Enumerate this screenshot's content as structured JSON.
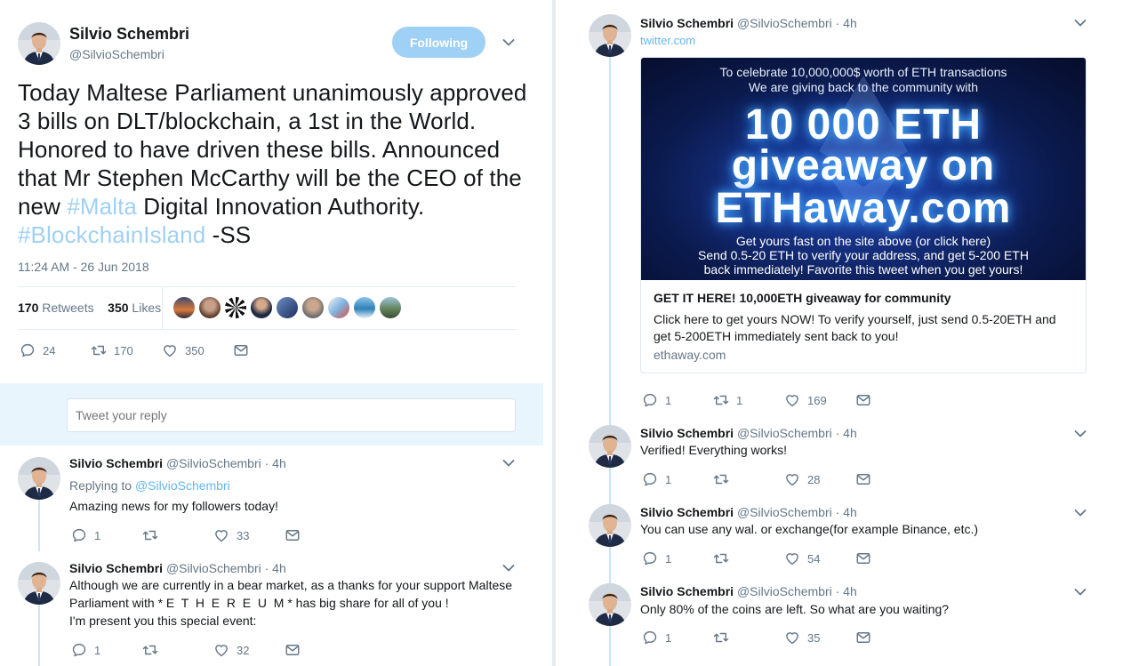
{
  "main_tweet": {
    "author_name": "Silvio Schembri",
    "author_handle": "@SilvioSchembri",
    "follow_label": "Following",
    "text_parts": [
      "Today Maltese Parliament unanimously approved 3 bills on DLT/blockchain, a 1st in the World. Honored to have driven these bills. Announced that Mr Stephen McCarthy will be the CEO of the new ",
      "#Malta",
      " Digital Innovation Authority.  ",
      "#BlockchainIsland",
      " -SS"
    ],
    "timestamp": "11:24 AM - 26 Jun 2018",
    "retweets_count": "170",
    "retweets_label": "Retweets",
    "likes_count": "350",
    "likes_label": "Likes",
    "action_replies": "24",
    "action_retweets": "170",
    "action_likes": "350"
  },
  "reply_input": {
    "placeholder": "Tweet your reply"
  },
  "left_replies": [
    {
      "name": "Silvio Schembri",
      "handle_time": "@SilvioSchembri · 4h",
      "replying_prefix": "Replying to",
      "replying_to": "@SilvioSchembri",
      "text_lines": [
        "Amazing news for my followers today!"
      ],
      "replies": "1",
      "retweets": "",
      "likes": "33"
    },
    {
      "name": "Silvio Schembri",
      "handle_time": "@SilvioSchembri · 4h",
      "text_lines": [
        "Although we are currently in a bear market, as a thanks for your support Maltese",
        "Parliament with * E  T  H  E  R  E  U  M * has big share for all of you !",
        "I'm present you this special event:"
      ],
      "replies": "1",
      "retweets": "",
      "likes": "32"
    }
  ],
  "right_tweets": [
    {
      "name": "Silvio Schembri",
      "handle_time": "@SilvioSchembri · 4h",
      "link": "twitter.com",
      "card": {
        "img_line1": "To celebrate 10,000,000$ worth of ETH transactions",
        "img_line2": "We are giving back to the community with",
        "img_big1": "10 000 ETH",
        "img_big2": "giveaway on",
        "img_big3": "ETHaway.com",
        "img_small1": "Get yours fast on the site above (or click here)",
        "img_small2": "Send 0.5-20 ETH to verify your address, and get 5-200 ETH",
        "img_small3": "back immediately! Favorite this tweet when you get yours!",
        "title": "GET IT HERE! 10,000ETH giveaway for community",
        "desc_line1": "Click here to get yours NOW! To verify yourself, just send 0.5-20ETH and",
        "desc_line2": "get 5-200ETH immediately sent back to you!",
        "domain": "ethaway.com"
      },
      "replies": "1",
      "retweets": "1",
      "likes": "169"
    },
    {
      "name": "Silvio Schembri",
      "handle_time": "@SilvioSchembri · 4h",
      "text": "Verified! Everything works!",
      "replies": "1",
      "retweets": "",
      "likes": "28"
    },
    {
      "name": "Silvio Schembri",
      "handle_time": "@SilvioSchembri · 4h",
      "text": "You can use any wal. or exchange(for example Binance, etc.)",
      "replies": "1",
      "retweets": "",
      "likes": "54"
    },
    {
      "name": "Silvio Schembri",
      "handle_time": "@SilvioSchembri · 4h",
      "text": "Only 80% of the coins are left. So what are you waiting?",
      "replies": "1",
      "retweets": "",
      "likes": "35"
    }
  ],
  "colors": {
    "accent": "#1da1f2",
    "follow_button": "#9fd0f5",
    "hashtag": "#9fd0f5",
    "muted": "#657786",
    "reply_area_bg": "#e8f5fd",
    "thread_line": "#c6e6fb"
  },
  "icons": [
    "reply-icon",
    "retweet-icon",
    "like-icon",
    "message-icon",
    "chevron-down-icon"
  ]
}
